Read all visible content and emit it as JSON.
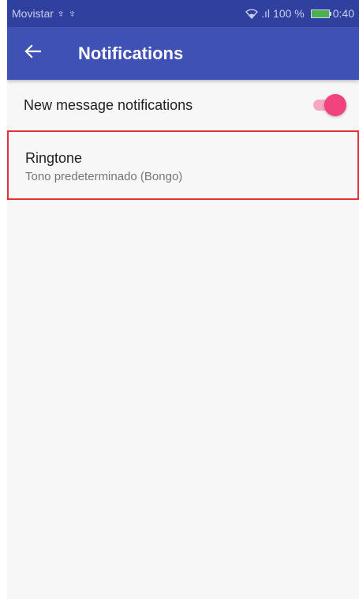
{
  "status_bar": {
    "carrier": "Movistar",
    "signal": ".ıl",
    "battery_percent": "100 %",
    "time": "0:40",
    "usb_icons": [
      "usb-icon",
      "usb-icon"
    ],
    "icons": [
      "wifi-icon",
      "signal-icon",
      "battery-icon"
    ]
  },
  "toolbar": {
    "title": "Notifications",
    "back_icon": "arrow-back-icon",
    "color": "#3f51b5"
  },
  "settings": {
    "new_message": {
      "label": "New message notifications",
      "enabled": true,
      "accent": "#f3437e"
    },
    "ringtone": {
      "label": "Ringtone",
      "summary": "Tono predeterminado (Bongo)"
    }
  }
}
